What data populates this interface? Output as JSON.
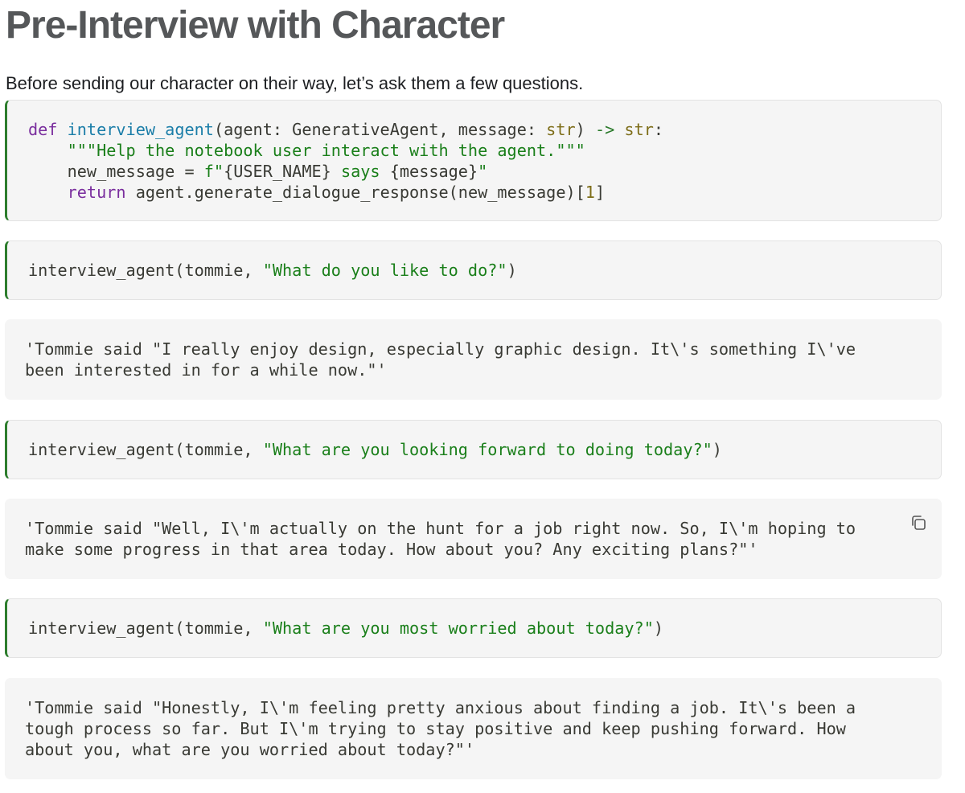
{
  "heading": "Pre-Interview with Character",
  "intro": "Before sending our character on their way, let’s ask them a few questions.",
  "cells": {
    "def_code": {
      "l1": {
        "kw": "def",
        "fn": "interview_agent",
        "a": "(agent: GenerativeAgent, message: ",
        "t1": "str",
        "b": ") ",
        "arrow": "->",
        "t2": "str",
        "c": ":"
      },
      "l2": "\"\"\"Help the notebook user interact with the agent.\"\"\"",
      "l3": {
        "a": "new_message = ",
        "s1": "f\"",
        "v1": "{USER_NAME}",
        "s2": " says ",
        "v2": "{message}",
        "s3": "\""
      },
      "l4": {
        "kw": "return",
        "a": " agent.generate_dialogue_response(new_message)[",
        "n": "1",
        "b": "]"
      }
    },
    "q1": {
      "call": "interview_agent(tommie, ",
      "arg": "\"What do you like to do?\"",
      "close": ")"
    },
    "o1": {
      "lines": [
        "'Tommie said \"I really enjoy design, especially graphic design. It\\'s something I\\'ve",
        "been interested in for a while now.\"'"
      ]
    },
    "q2": {
      "call": "interview_agent(tommie, ",
      "arg": "\"What are you looking forward to doing today?\"",
      "close": ")"
    },
    "o2": {
      "lines": [
        "'Tommie said \"Well, I\\'m actually on the hunt for a job right now. So, I\\'m hoping to",
        "make some progress in that area today. How about you? Any exciting plans?\"'"
      ],
      "copy_icon": "copy-icon"
    },
    "q3": {
      "call": "interview_agent(tommie, ",
      "arg": "\"What are you most worried about today?\"",
      "close": ")"
    },
    "o3": {
      "lines": [
        "'Tommie said \"Honestly, I\\'m feeling pretty anxious about finding a job. It\\'s been a",
        "tough process so far. But I\\'m trying to stay positive and keep pushing forward. How",
        "about you, what are you worried about today?\"'"
      ]
    }
  }
}
